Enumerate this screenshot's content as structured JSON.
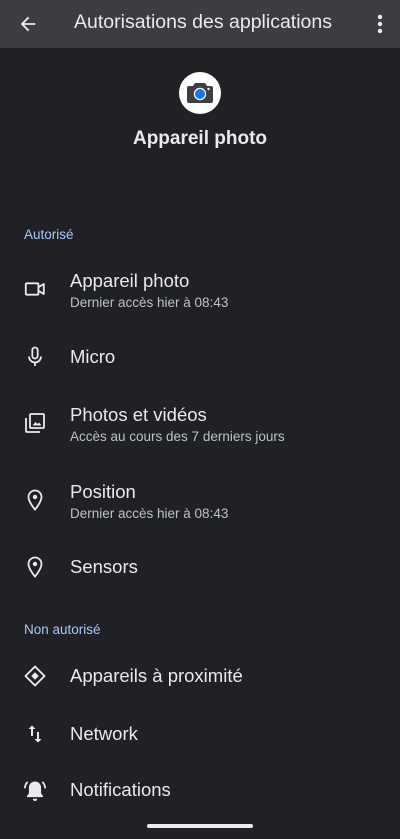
{
  "appbar": {
    "title": "Autorisations des applications",
    "back_icon": "arrow-back-icon",
    "more_icon": "more-vert-icon"
  },
  "app": {
    "name": "Appareil photo",
    "icon": "camera-app-icon"
  },
  "sections": {
    "allowed": {
      "label": "Autorisé",
      "items": [
        {
          "label": "Appareil photo",
          "sub": "Dernier accès hier à 08:43",
          "icon": "videocam-icon"
        },
        {
          "label": "Micro",
          "sub": "",
          "icon": "mic-icon"
        },
        {
          "label": "Photos et vidéos",
          "sub": "Accès au cours des 7 derniers jours",
          "icon": "photo-library-icon"
        },
        {
          "label": "Position",
          "sub": "Dernier accès hier à 08:43",
          "icon": "location-icon"
        },
        {
          "label": "Sensors",
          "sub": "",
          "icon": "location-icon"
        }
      ]
    },
    "denied": {
      "label": "Non autorisé",
      "items": [
        {
          "label": "Appareils à proximité",
          "sub": "",
          "icon": "nearby-devices-icon"
        },
        {
          "label": "Network",
          "sub": "",
          "icon": "swap-vert-icon"
        },
        {
          "label": "Notifications",
          "sub": "",
          "icon": "notifications-icon"
        }
      ]
    }
  },
  "colors": {
    "background": "#202124",
    "appbar": "#3c3d41",
    "section_label": "#a8c7fa",
    "text_primary": "#e8eaed",
    "text_secondary": "#bdc1c6",
    "camera_lens": "#1a73e8"
  }
}
